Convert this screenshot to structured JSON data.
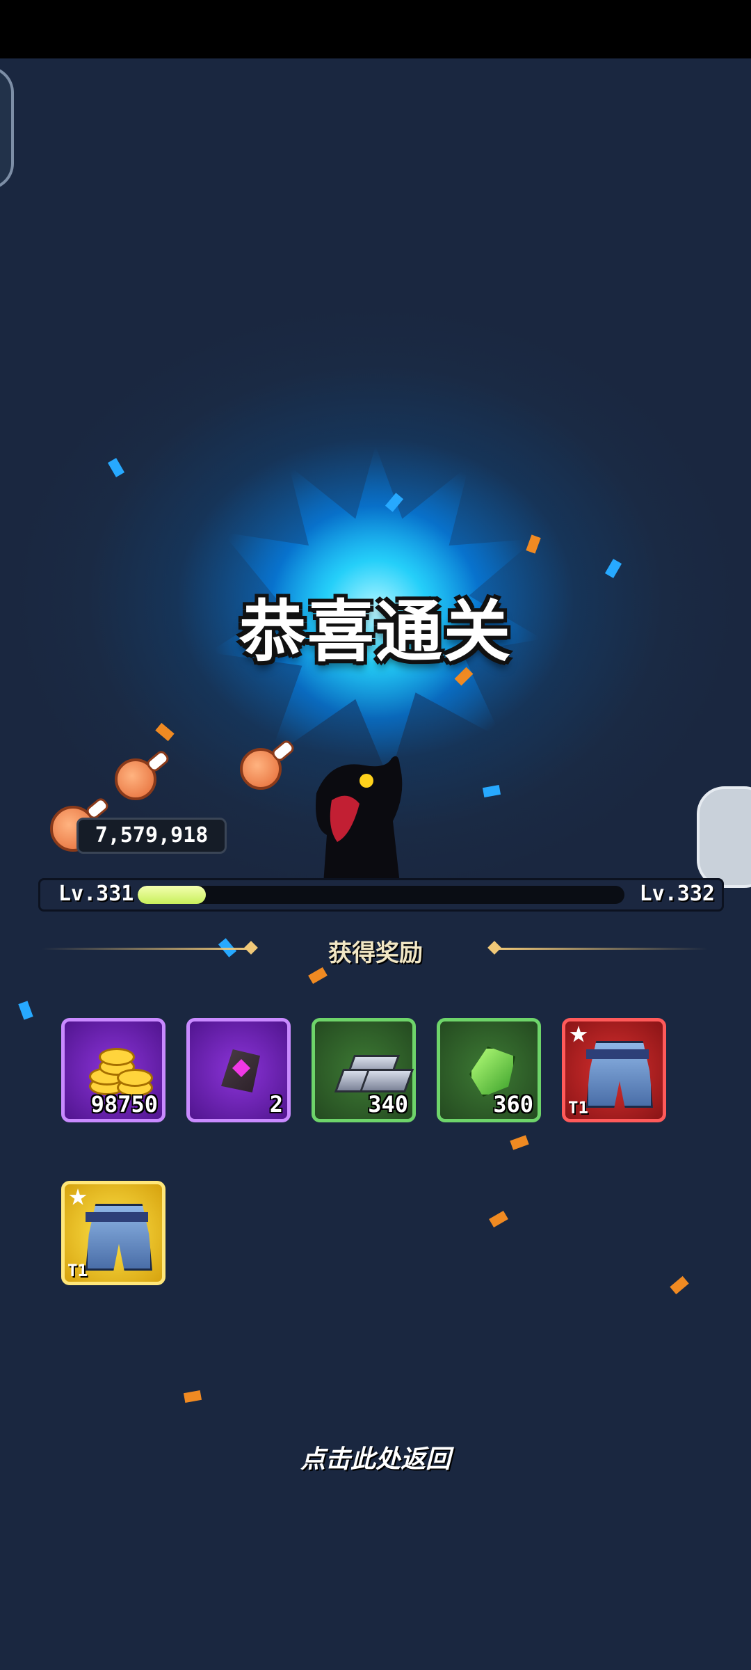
{
  "title": "恭喜通关",
  "score": "7,579,918",
  "level": {
    "current": "Lv.331",
    "next": "Lv.332",
    "progress": 0.14
  },
  "rewards_title": "获得奖励",
  "rewards": [
    {
      "name": "gold-coins",
      "count": "98750",
      "rarity": "purple"
    },
    {
      "name": "purple-gem-stone",
      "count": "2",
      "rarity": "purple"
    },
    {
      "name": "silver-ingots",
      "count": "340",
      "rarity": "green"
    },
    {
      "name": "green-crystal",
      "count": "360",
      "rarity": "green"
    },
    {
      "name": "armor-pants",
      "tier": "T1",
      "rarity": "red"
    },
    {
      "name": "armor-pants",
      "tier": "T1",
      "rarity": "gold"
    }
  ],
  "return_text": "点击此处返回",
  "colors": {
    "accent_blue": "#1aa7ff",
    "xp_fill": "#c8ef5c",
    "purple": "#8b34d8",
    "green": "#3d7a34",
    "red": "#d8302f",
    "gold": "#ffe44a"
  }
}
